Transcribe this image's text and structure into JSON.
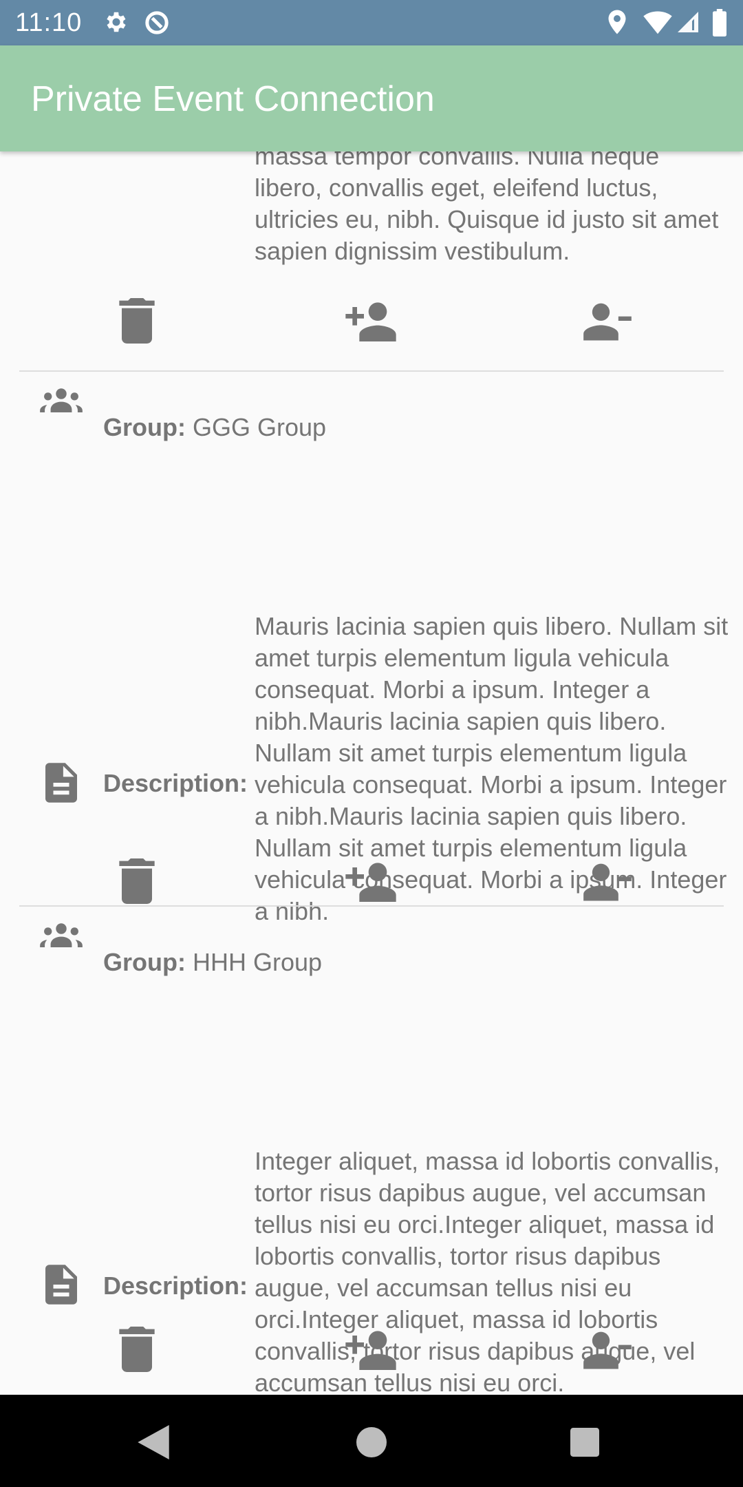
{
  "status_bar": {
    "time": "11:10",
    "icons": [
      "gear-icon",
      "sync-icon",
      "location-icon",
      "wifi-icon",
      "signal-icon",
      "battery-icon"
    ],
    "background": "#6389a6"
  },
  "app_bar": {
    "title": "Private Event Connection",
    "background": "#9bcda9"
  },
  "labels": {
    "group": "Group:",
    "description": "Description:"
  },
  "groups": [
    {
      "name": "",
      "description": "massa tempor convallis. Nulla neque libero, convallis eget, eleifend luctus, ultricies eu, nibh. Quisque id justo sit amet sapien dignissim vestibulum."
    },
    {
      "name": "GGG Group",
      "description": "Mauris lacinia sapien quis libero. Nullam sit amet turpis elementum ligula vehicula consequat. Morbi a ipsum. Integer a nibh.Mauris lacinia sapien quis libero. Nullam sit amet turpis elementum ligula vehicula consequat. Morbi a ipsum. Integer a nibh.Mauris lacinia sapien quis libero. Nullam sit amet turpis elementum ligula vehicula consequat. Morbi a ipsum. Integer a nibh."
    },
    {
      "name": "HHH Group",
      "description": "Integer aliquet, massa id lobortis convallis, tortor risus dapibus augue, vel accumsan tellus nisi eu orci.Integer aliquet, massa id lobortis convallis, tortor risus dapibus augue, vel accumsan tellus nisi eu orci.Integer aliquet, massa id lobortis convallis, tortor risus dapibus augue, vel accumsan tellus nisi eu orci."
    }
  ],
  "actions": [
    "delete-icon",
    "person-add-icon",
    "person-remove-icon"
  ],
  "colors": {
    "text": "#757575",
    "divider": "#dddddd",
    "background": "#fafafa"
  },
  "nav_bar": {
    "buttons": [
      "back-button",
      "home-button",
      "recents-button"
    ]
  }
}
